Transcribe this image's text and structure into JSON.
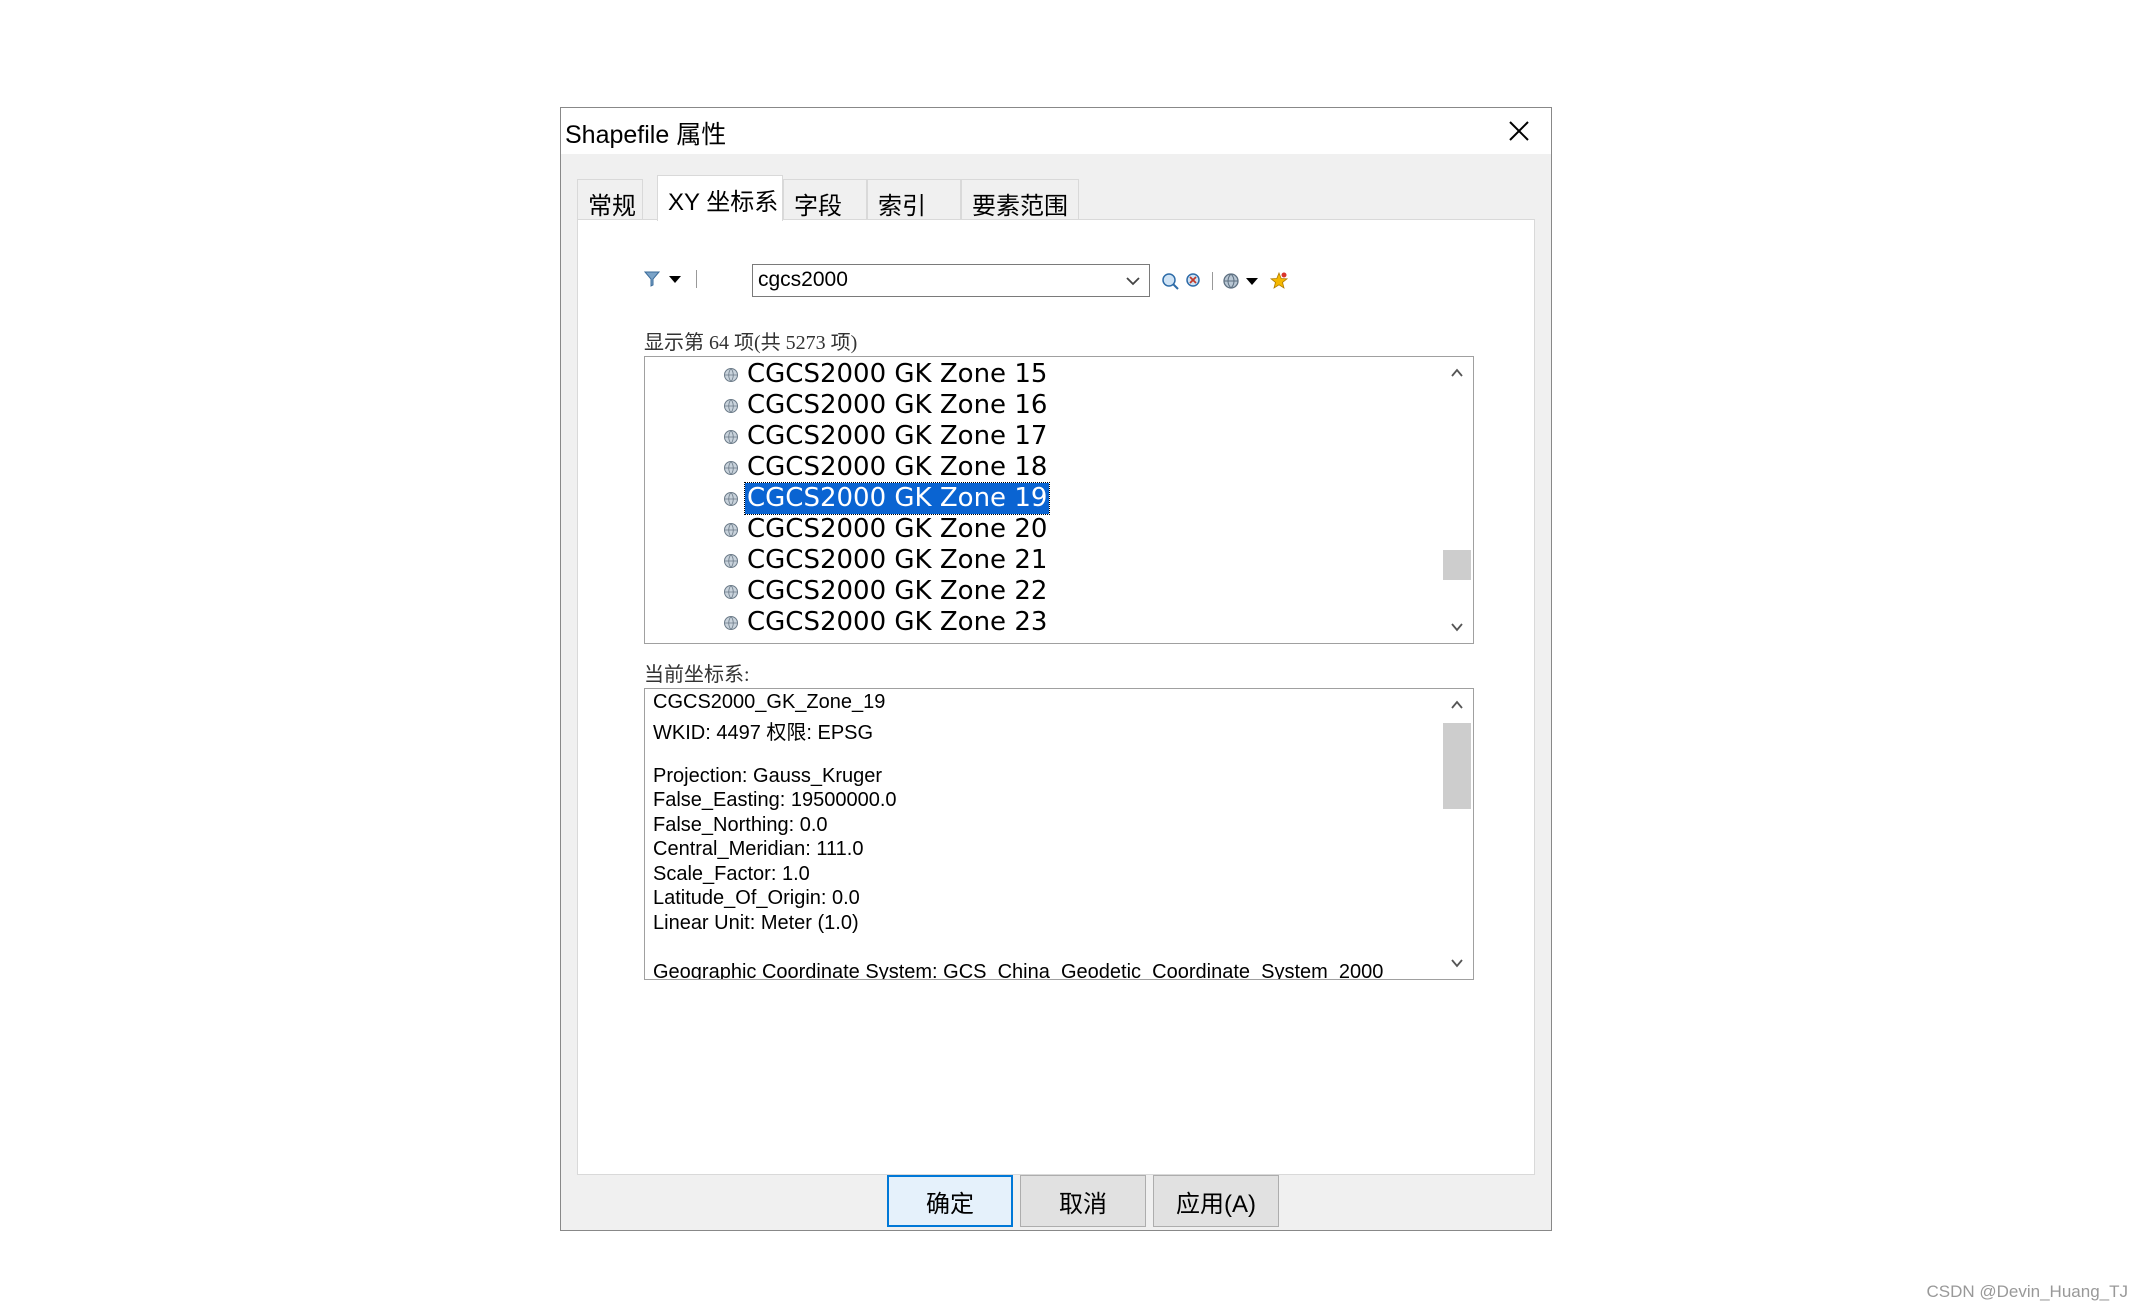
{
  "dialog": {
    "title": "Shapefile 属性",
    "tabs": [
      "常规",
      "XY 坐标系",
      "字段",
      "索引",
      "要素范围"
    ],
    "active_tab": "XY 坐标系"
  },
  "search": {
    "value": "cgcs2000"
  },
  "list": {
    "count_label": "显示第 64 项(共 5273 项)",
    "items": [
      "CGCS2000 GK Zone 15",
      "CGCS2000 GK Zone 16",
      "CGCS2000 GK Zone 17",
      "CGCS2000 GK Zone 18",
      "CGCS2000 GK Zone 19",
      "CGCS2000 GK Zone 20",
      "CGCS2000 GK Zone 21",
      "CGCS2000 GK Zone 22",
      "CGCS2000 GK Zone 23"
    ],
    "selected_index": 4,
    "scroll_position": 0.85
  },
  "current": {
    "label": "当前坐标系:",
    "lines": [
      "CGCS2000_GK_Zone_19",
      "WKID: 4497 权限: EPSG",
      "",
      "Projection: Gauss_Kruger",
      "False_Easting: 19500000.0",
      "False_Northing: 0.0",
      "Central_Meridian: 111.0",
      "Scale_Factor: 1.0",
      "Latitude_Of_Origin: 0.0",
      "Linear Unit: Meter (1.0)",
      "",
      "Geographic Coordinate System: GCS_China_Geodetic_Coordinate_System_2000"
    ]
  },
  "buttons": {
    "ok": "确定",
    "cancel": "取消",
    "apply": "应用(A)"
  },
  "watermark": "CSDN @Devin_Huang_TJ",
  "colors": {
    "selection": "#0a64d2",
    "default_button_border": "#0078d7"
  },
  "icons": [
    "filter-icon",
    "dropdown-arrow-icon",
    "search-globe-icon",
    "clear-search-icon",
    "globe-add-icon",
    "favorite-star-icon",
    "close-icon",
    "chevron-down-icon",
    "chevron-up-icon",
    "globe-icon"
  ]
}
